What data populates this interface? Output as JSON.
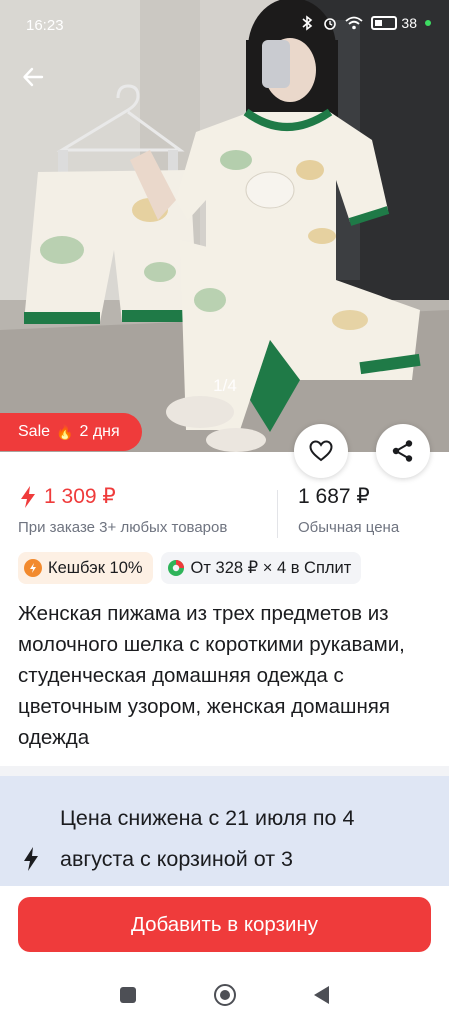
{
  "status_bar": {
    "time": "16:23",
    "battery_percent": "38",
    "battery_level": 0.38
  },
  "gallery": {
    "counter": "1/4",
    "current": 1,
    "total": 4
  },
  "sale_badge": {
    "label": "Sale",
    "icon": "fire-icon",
    "duration": "2 дня"
  },
  "price": {
    "discounted": "1 309 ₽",
    "discounted_note": "При заказе 3+ любых товаров",
    "regular": "1 687 ₽",
    "regular_note": "Обычная цена"
  },
  "chips": {
    "cashback": "Кешбэк 10%",
    "split": "От 328 ₽ × 4 в Сплит"
  },
  "product_title": "Женская пижама из трех предметов из молочного шелка с короткими рукавами, студенческая домашняя одежда с цветочным узором, женская домашняя одежда",
  "promo": {
    "text": "Цена снижена с 21 июля по 4 августа с корзиной от 3"
  },
  "add_to_cart_label": "Добавить в корзину",
  "colors": {
    "accent": "#ef3b3b",
    "promo_bg": "#dfe6f4",
    "muted_text": "#6f7480",
    "split_green": "#2fb45a"
  }
}
